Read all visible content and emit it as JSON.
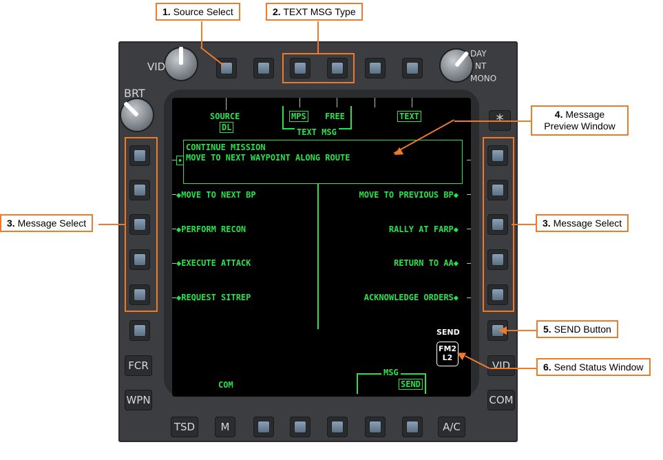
{
  "bezel": {
    "knob_left_label": "VID",
    "knob_right_labels": [
      "DAY",
      "NT",
      "MONO"
    ],
    "brt_label": "BRT",
    "left_labels": [
      "FCR",
      "WPN"
    ],
    "right_labels": [
      "VID",
      "COM"
    ],
    "bottom_labels": [
      "TSD",
      "M",
      "A/C"
    ],
    "asterisk": "*"
  },
  "screen": {
    "source_label": "SOURCE",
    "source_value": "DL",
    "mps_label": "MPS",
    "free_label": "FREE",
    "text_msg_label": "TEXT MSG",
    "text_label": "TEXT",
    "preview_line1": "CONTINUE MISSION",
    "preview_line2": "MOVE TO NEXT WAYPOINT ALONG ROUTE",
    "preview_marker": "◆",
    "left_messages": [
      "◆MOVE TO NEXT BP",
      "◆PERFORM RECON",
      "◆EXECUTE ATTACK",
      "◆REQUEST SITREP"
    ],
    "right_messages": [
      "MOVE TO PREVIOUS BP◆",
      "RALLY AT FARP◆",
      "RETURN TO AA◆",
      "ACKNOWLEDGE ORDERS◆"
    ],
    "send_label": "SEND",
    "status_line1": "FM2",
    "status_line2": "L2",
    "com_label": "COM",
    "msg_label": "MSG",
    "msg_send_label": "SEND"
  },
  "callouts": {
    "c1_num": "1.",
    "c1_text": "Source Select",
    "c2_num": "2.",
    "c2_text": "TEXT MSG Type",
    "c3l_num": "3.",
    "c3l_text": "Message Select",
    "c3r_num": "3.",
    "c3r_text": "Message Select",
    "c4_num": "4.",
    "c4_text1": "Message",
    "c4_text2": "Preview Window",
    "c5_num": "5.",
    "c5_text": "SEND Button",
    "c6_num": "6.",
    "c6_text": "Send Status Window"
  },
  "colors": {
    "accent": "#ee7a2a",
    "display_green": "#27e24a",
    "bezel": "#3b3d40"
  }
}
